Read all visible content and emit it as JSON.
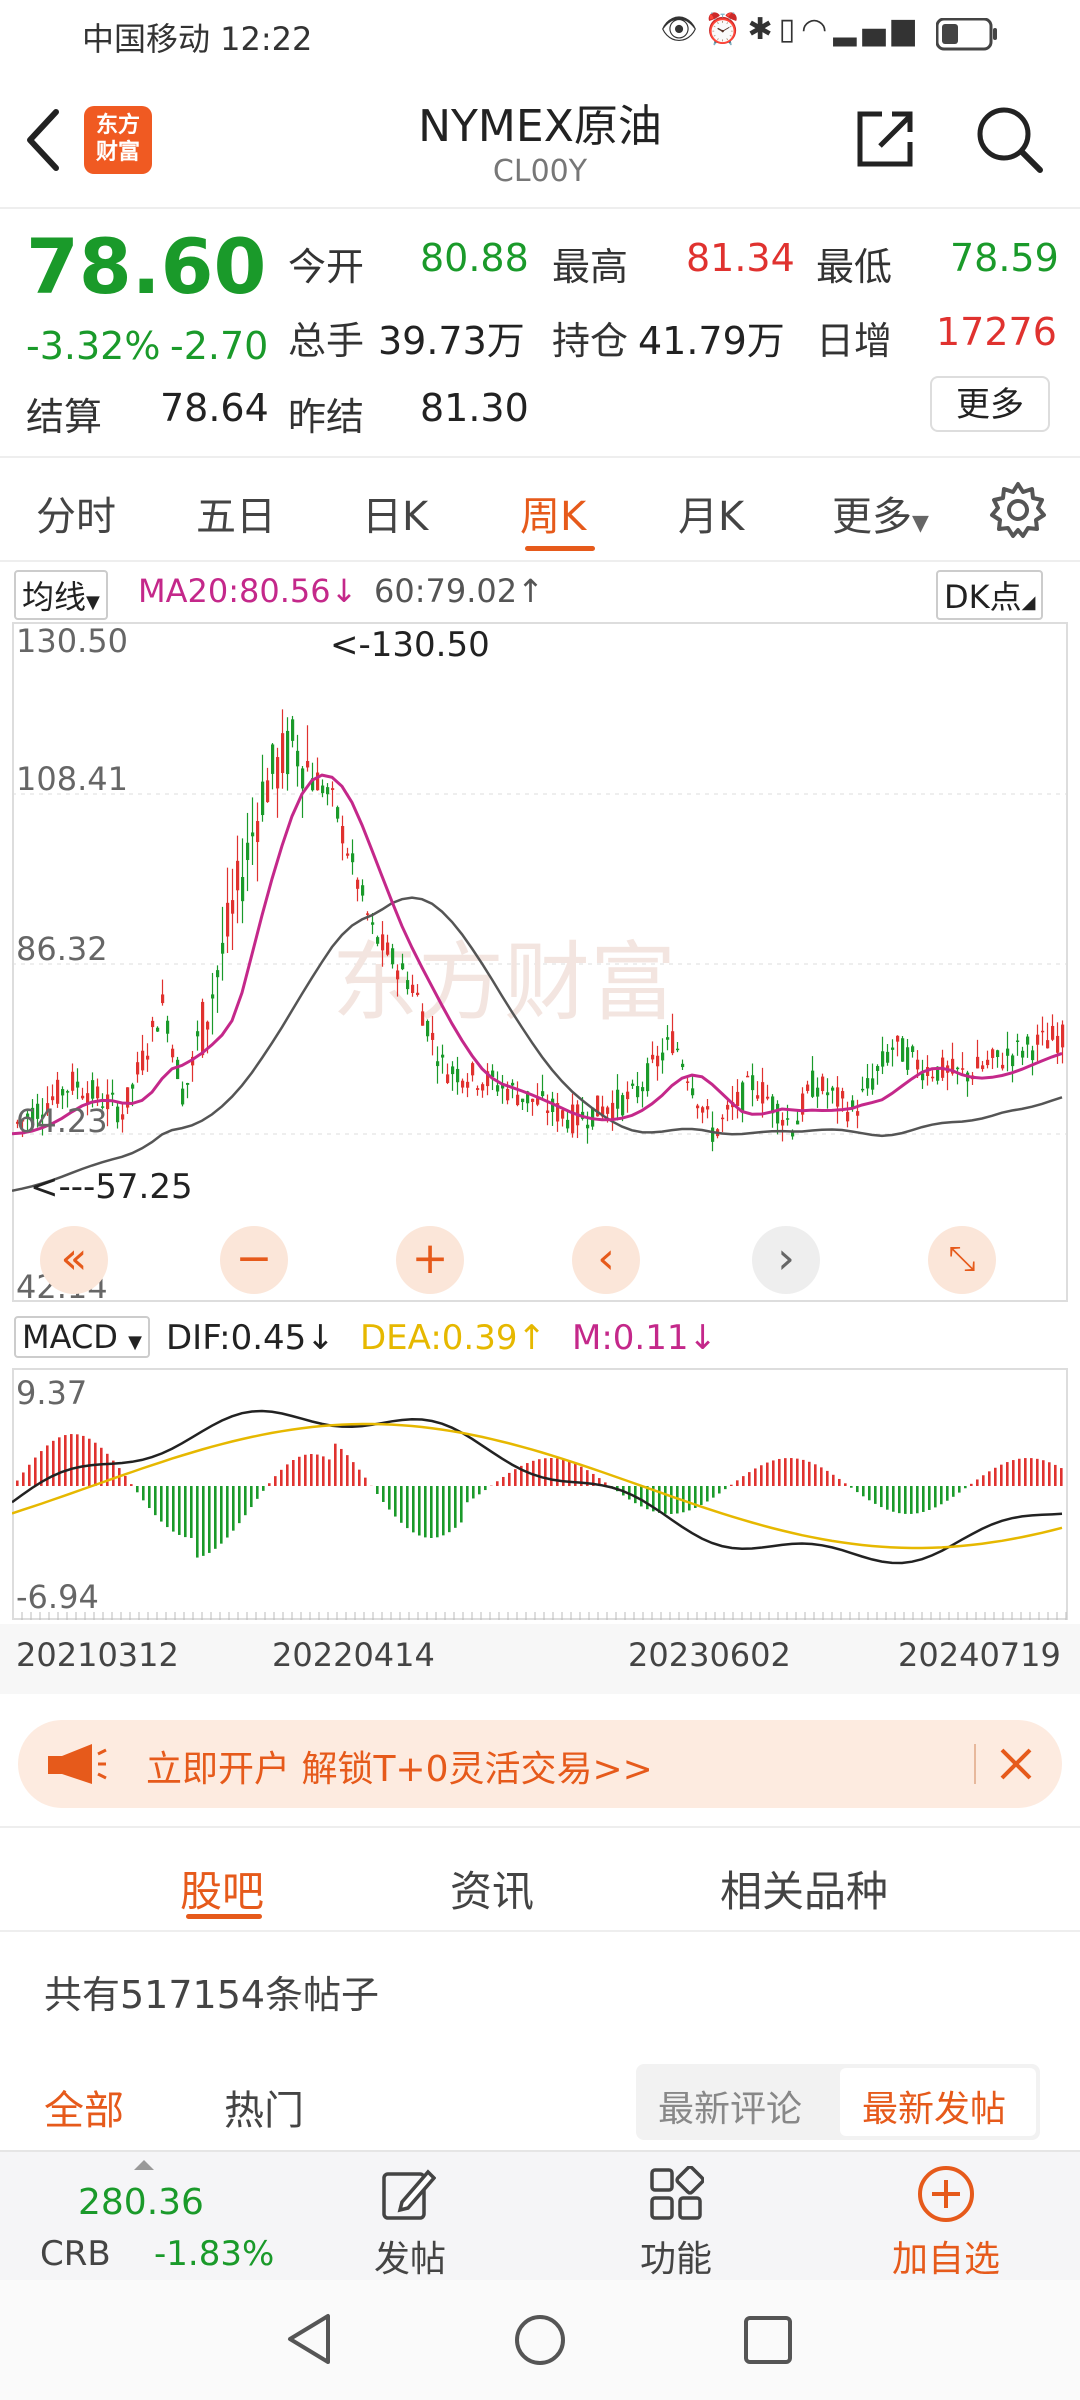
{
  "status": {
    "carrier_time": "中国移动 12:22",
    "icons": [
      "eye-icon",
      "alarm-icon",
      "bluetooth-icon",
      "vibrate-icon",
      "wifi-icon",
      "signal-icon",
      "battery-icon"
    ]
  },
  "header": {
    "logo_line1": "东方",
    "logo_line2": "财富",
    "title": "NYMEX原油",
    "code": "CL00Y"
  },
  "quote": {
    "price": "78.60",
    "change_pct": "-3.32%",
    "change": "-2.70",
    "open_label": "今开",
    "open": "80.88",
    "high_label": "最高",
    "high": "81.34",
    "low_label": "最低",
    "low": "78.59",
    "volume_label": "总手",
    "volume": "39.73万",
    "oi_label": "持仓",
    "oi": "41.79万",
    "daily_inc_label": "日增",
    "daily_inc": "17276",
    "settle_label": "结算",
    "settle": "78.64",
    "prev_settle_label": "昨结",
    "prev_settle": "81.30",
    "more": "更多"
  },
  "tabs": [
    "分时",
    "五日",
    "日K",
    "周K",
    "月K",
    "更多"
  ],
  "chart": {
    "ma_selector": "均线",
    "ma20": "MA20:80.56",
    "ma60": "60:79.02",
    "dk_button": "DK点",
    "y_labels": [
      "130.50",
      "108.41",
      "86.32",
      "64.23",
      "42.14"
    ],
    "max_note": "<-130.50",
    "min_note": "<---57.25",
    "watermark": "东方财富",
    "macd_selector": "MACD",
    "dif": "DIF:0.45",
    "dea": "DEA:0.39",
    "m": "M:0.11",
    "macd_y": [
      "9.37",
      "-6.94"
    ],
    "x_labels": [
      "20210312",
      "20220414",
      "20230602",
      "20240719"
    ],
    "colors": {
      "up": "#e0322f",
      "down": "#1a9a2a",
      "ma20": "#c4288a",
      "ma60": "#555555",
      "dea": "#e6b800"
    }
  },
  "banner": {
    "text": "立即开户 解锁T+0灵活交易>>"
  },
  "section_tabs": [
    "股吧",
    "资讯",
    "相关品种"
  ],
  "post_count": "共有517154条帖子",
  "filters": {
    "all": "全部",
    "hot": "热门",
    "latest_comment": "最新评论",
    "latest_post": "最新发帖"
  },
  "bottom": {
    "crb_value": "280.36",
    "crb_label": "CRB",
    "crb_change": "-1.83%",
    "post": "发帖",
    "func": "功能",
    "add": "加自选"
  }
}
